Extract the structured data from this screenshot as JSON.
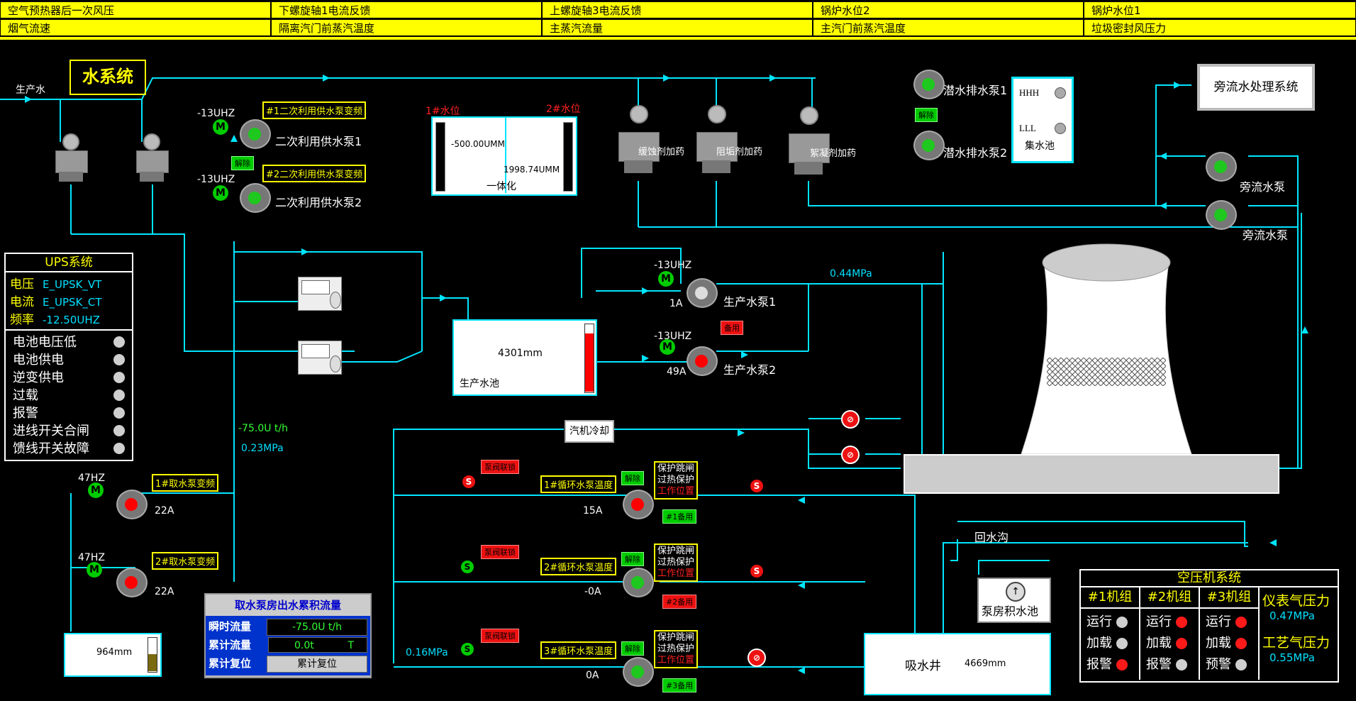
{
  "top_bar": {
    "row1": [
      "空气预热器后一次风压",
      "下螺旋轴1电流反馈",
      "上螺旋轴3电流反馈",
      "锅炉水位2",
      "锅炉水位1"
    ],
    "row2": [
      "烟气流速",
      "隔离汽门前蒸汽温度",
      "主蒸汽流量",
      "主汽门前蒸汽温度",
      "垃圾密封风压力"
    ]
  },
  "title": "水系统",
  "labels": {
    "production_water": "生产水",
    "secondary_pump1": "二次利用供水泵1",
    "secondary_pump2": "二次利用供水泵2",
    "secondary_pump1_tag": "#1二次利用供水泵变频",
    "secondary_pump2_tag": "#2二次利用供水泵变频",
    "secondary_pump1_freq": "-13UHZ",
    "secondary_pump2_freq": "-13UHZ",
    "release": "解除",
    "level1_tag": "1#水位",
    "level2_tag": "2#水位",
    "level1_value": "-500.00UMM",
    "level2_value": "1998.74UMM",
    "integrated": "一体化",
    "dosing1": "缓蚀剂加药",
    "dosing2": "阻垢剂加药",
    "dosing3": "絮凝剂加药",
    "sump_pump1": "潜水排水泵1",
    "sump_pump2": "潜水排水泵2",
    "hhh": "HHH",
    "lll": "LLL",
    "collection_pool": "集水池",
    "bypass_system": "旁流水处理系统",
    "bypass_pump1": "旁流水泵",
    "bypass_pump2": "旁流水泵",
    "prod_pump1": "生产水泵1",
    "prod_pump2": "生产水泵2",
    "prod_pump1_freq": "-13UHZ",
    "prod_pump2_freq": "-13UHZ",
    "prod_pump1_amp": "1A",
    "prod_pump2_amp": "49A",
    "standby": "备用",
    "prod_pressure": "0.44MPa",
    "prod_pool_level": "4301mm",
    "prod_pool": "生产水池",
    "flow_value": "-75.0U t/h",
    "intake_pressure": "0.23MPa",
    "turbine_cooling": "汽机冷却",
    "intake_pump1_tag": "1#取水泵变频",
    "intake_pump2_tag": "2#取水泵变频",
    "intake_pump1_freq": "47HZ",
    "intake_pump2_freq": "47HZ",
    "intake_pump1_amp": "22A",
    "intake_pump2_amp": "22A",
    "intake_pool_level": "964mm",
    "circ_pump1_temp": "1#循环水泵温度",
    "circ_pump2_temp": "2#循环水泵温度",
    "circ_pump3_temp": "3#循环水泵温度",
    "pump_valve_link": "泵阀联锁",
    "protect_trip": "保护跳闸",
    "overheat_protect": "过热保护",
    "work_position": "工作位置",
    "circ_pump1_amp": "15A",
    "circ_pump2_amp": "-0A",
    "circ_pump3_amp": "0A",
    "circ_standby1": "#1备用",
    "circ_standby2": "#2备用",
    "circ_standby3": "#3备用",
    "circ_pressure": "0.16MPa",
    "return_ditch": "回水沟",
    "pump_room_pool": "泵房积水池",
    "suction_well": "吸水井",
    "suction_well_level": "4669mm"
  },
  "ups": {
    "title": "UPS系统",
    "rows": [
      {
        "name": "电压",
        "value": "E_UPSK_VT"
      },
      {
        "name": "电流",
        "value": "E_UPSK_CT"
      },
      {
        "name": "频率",
        "value": "-12.50UHZ"
      }
    ],
    "status": [
      {
        "name": "电池电压低"
      },
      {
        "name": "电池供电"
      },
      {
        "name": "逆变供电"
      },
      {
        "name": "过载"
      },
      {
        "name": "报警"
      },
      {
        "name": "进线开关合闸"
      },
      {
        "name": "馈线开关故障"
      }
    ]
  },
  "flow_panel": {
    "title": "取水泵房出水累积流量",
    "instant_label": "瞬时流量",
    "instant_value": "-75.0U t/h",
    "total_label": "累计流量",
    "total_value": "0.0t",
    "total_unit": "T",
    "reset_label": "累计复位",
    "reset_button": "累计复位"
  },
  "compressor": {
    "title": "空压机系统",
    "units": [
      {
        "name": "#1机组",
        "items": [
          {
            "label": "运行",
            "state": "grey"
          },
          {
            "label": "加载",
            "state": "grey"
          },
          {
            "label": "报警",
            "state": "red"
          }
        ]
      },
      {
        "name": "#2机组",
        "items": [
          {
            "label": "运行",
            "state": "red"
          },
          {
            "label": "加载",
            "state": "red"
          },
          {
            "label": "报警",
            "state": "grey"
          }
        ]
      },
      {
        "name": "#3机组",
        "items": [
          {
            "label": "运行",
            "state": "red"
          },
          {
            "label": "加载",
            "state": "red"
          },
          {
            "label": "预警",
            "state": "grey"
          }
        ]
      }
    ],
    "instrument_air_label": "仪表气压力",
    "instrument_air_value": "0.47MPa",
    "process_air_label": "工艺气压力",
    "process_air_value": "0.55MPa"
  }
}
